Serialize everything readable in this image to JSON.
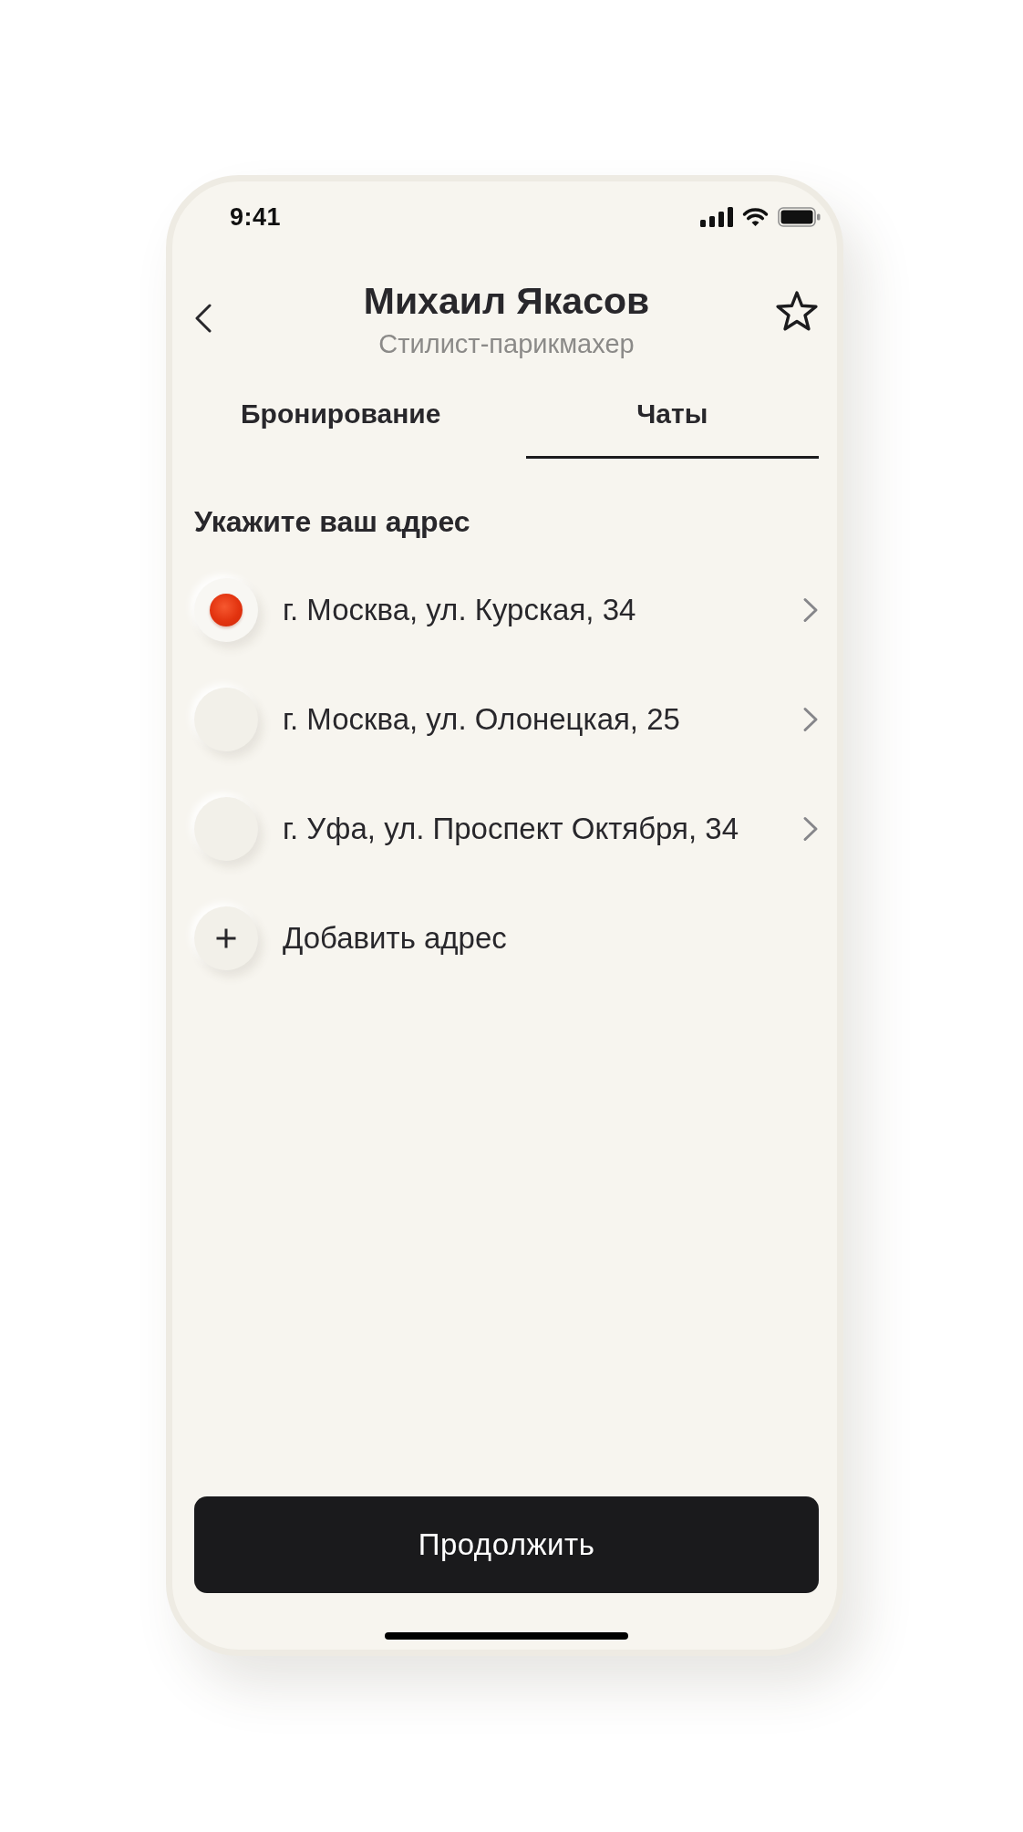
{
  "status_bar": {
    "time": "9:41"
  },
  "header": {
    "title": "Михаил Якасов",
    "subtitle": "Стилист-парикмахер"
  },
  "tabs": [
    {
      "label": "Бронирование",
      "selected": false
    },
    {
      "label": "Чаты",
      "selected": true
    }
  ],
  "address_section": {
    "heading": "Укажите ваш адрес",
    "addresses": [
      {
        "text": "г. Москва, ул. Курская, 34",
        "selected": true
      },
      {
        "text": "г. Москва, ул. Олонецкая, 25",
        "selected": false
      },
      {
        "text": "г. Уфа, ул. Проспект Октября, 34",
        "selected": false
      }
    ],
    "add_label": "Добавить адрес"
  },
  "continue_button": {
    "label": "Продолжить"
  }
}
